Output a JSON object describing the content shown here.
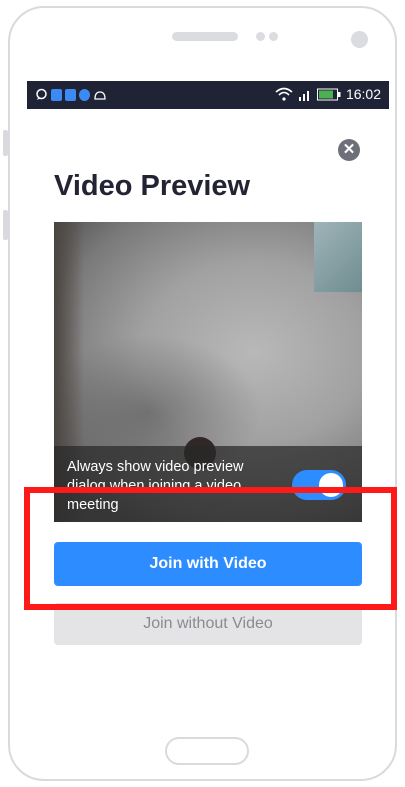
{
  "statusbar": {
    "time": "16:02",
    "notification_icons": [
      "chat-icon",
      "app-icon",
      "app-icon",
      "bubble-icon",
      "android-icon"
    ],
    "bg_color": "#1f2335"
  },
  "dialog": {
    "title": "Video Preview",
    "close_icon": "close-icon",
    "toggle_label": "Always show video preview dialog when joining a video meeting",
    "toggle_on": true,
    "join_with_video_label": "Join with Video",
    "join_without_video_label": "Join without Video"
  },
  "colors": {
    "accent": "#2d8cff",
    "highlight": "#ff1a1a",
    "secondary_button": "#e4e4e6"
  }
}
